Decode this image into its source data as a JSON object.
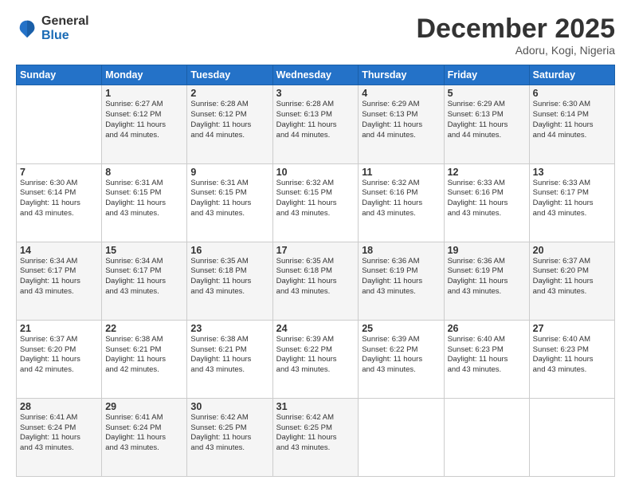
{
  "logo": {
    "general": "General",
    "blue": "Blue"
  },
  "header": {
    "month": "December 2025",
    "location": "Adoru, Kogi, Nigeria"
  },
  "weekdays": [
    "Sunday",
    "Monday",
    "Tuesday",
    "Wednesday",
    "Thursday",
    "Friday",
    "Saturday"
  ],
  "weeks": [
    [
      {
        "day": "",
        "info": ""
      },
      {
        "day": "1",
        "info": "Sunrise: 6:27 AM\nSunset: 6:12 PM\nDaylight: 11 hours\nand 44 minutes."
      },
      {
        "day": "2",
        "info": "Sunrise: 6:28 AM\nSunset: 6:12 PM\nDaylight: 11 hours\nand 44 minutes."
      },
      {
        "day": "3",
        "info": "Sunrise: 6:28 AM\nSunset: 6:13 PM\nDaylight: 11 hours\nand 44 minutes."
      },
      {
        "day": "4",
        "info": "Sunrise: 6:29 AM\nSunset: 6:13 PM\nDaylight: 11 hours\nand 44 minutes."
      },
      {
        "day": "5",
        "info": "Sunrise: 6:29 AM\nSunset: 6:13 PM\nDaylight: 11 hours\nand 44 minutes."
      },
      {
        "day": "6",
        "info": "Sunrise: 6:30 AM\nSunset: 6:14 PM\nDaylight: 11 hours\nand 44 minutes."
      }
    ],
    [
      {
        "day": "7",
        "info": "Sunrise: 6:30 AM\nSunset: 6:14 PM\nDaylight: 11 hours\nand 43 minutes."
      },
      {
        "day": "8",
        "info": "Sunrise: 6:31 AM\nSunset: 6:15 PM\nDaylight: 11 hours\nand 43 minutes."
      },
      {
        "day": "9",
        "info": "Sunrise: 6:31 AM\nSunset: 6:15 PM\nDaylight: 11 hours\nand 43 minutes."
      },
      {
        "day": "10",
        "info": "Sunrise: 6:32 AM\nSunset: 6:15 PM\nDaylight: 11 hours\nand 43 minutes."
      },
      {
        "day": "11",
        "info": "Sunrise: 6:32 AM\nSunset: 6:16 PM\nDaylight: 11 hours\nand 43 minutes."
      },
      {
        "day": "12",
        "info": "Sunrise: 6:33 AM\nSunset: 6:16 PM\nDaylight: 11 hours\nand 43 minutes."
      },
      {
        "day": "13",
        "info": "Sunrise: 6:33 AM\nSunset: 6:17 PM\nDaylight: 11 hours\nand 43 minutes."
      }
    ],
    [
      {
        "day": "14",
        "info": "Sunrise: 6:34 AM\nSunset: 6:17 PM\nDaylight: 11 hours\nand 43 minutes."
      },
      {
        "day": "15",
        "info": "Sunrise: 6:34 AM\nSunset: 6:17 PM\nDaylight: 11 hours\nand 43 minutes."
      },
      {
        "day": "16",
        "info": "Sunrise: 6:35 AM\nSunset: 6:18 PM\nDaylight: 11 hours\nand 43 minutes."
      },
      {
        "day": "17",
        "info": "Sunrise: 6:35 AM\nSunset: 6:18 PM\nDaylight: 11 hours\nand 43 minutes."
      },
      {
        "day": "18",
        "info": "Sunrise: 6:36 AM\nSunset: 6:19 PM\nDaylight: 11 hours\nand 43 minutes."
      },
      {
        "day": "19",
        "info": "Sunrise: 6:36 AM\nSunset: 6:19 PM\nDaylight: 11 hours\nand 43 minutes."
      },
      {
        "day": "20",
        "info": "Sunrise: 6:37 AM\nSunset: 6:20 PM\nDaylight: 11 hours\nand 43 minutes."
      }
    ],
    [
      {
        "day": "21",
        "info": "Sunrise: 6:37 AM\nSunset: 6:20 PM\nDaylight: 11 hours\nand 42 minutes."
      },
      {
        "day": "22",
        "info": "Sunrise: 6:38 AM\nSunset: 6:21 PM\nDaylight: 11 hours\nand 42 minutes."
      },
      {
        "day": "23",
        "info": "Sunrise: 6:38 AM\nSunset: 6:21 PM\nDaylight: 11 hours\nand 43 minutes."
      },
      {
        "day": "24",
        "info": "Sunrise: 6:39 AM\nSunset: 6:22 PM\nDaylight: 11 hours\nand 43 minutes."
      },
      {
        "day": "25",
        "info": "Sunrise: 6:39 AM\nSunset: 6:22 PM\nDaylight: 11 hours\nand 43 minutes."
      },
      {
        "day": "26",
        "info": "Sunrise: 6:40 AM\nSunset: 6:23 PM\nDaylight: 11 hours\nand 43 minutes."
      },
      {
        "day": "27",
        "info": "Sunrise: 6:40 AM\nSunset: 6:23 PM\nDaylight: 11 hours\nand 43 minutes."
      }
    ],
    [
      {
        "day": "28",
        "info": "Sunrise: 6:41 AM\nSunset: 6:24 PM\nDaylight: 11 hours\nand 43 minutes."
      },
      {
        "day": "29",
        "info": "Sunrise: 6:41 AM\nSunset: 6:24 PM\nDaylight: 11 hours\nand 43 minutes."
      },
      {
        "day": "30",
        "info": "Sunrise: 6:42 AM\nSunset: 6:25 PM\nDaylight: 11 hours\nand 43 minutes."
      },
      {
        "day": "31",
        "info": "Sunrise: 6:42 AM\nSunset: 6:25 PM\nDaylight: 11 hours\nand 43 minutes."
      },
      {
        "day": "",
        "info": ""
      },
      {
        "day": "",
        "info": ""
      },
      {
        "day": "",
        "info": ""
      }
    ]
  ]
}
